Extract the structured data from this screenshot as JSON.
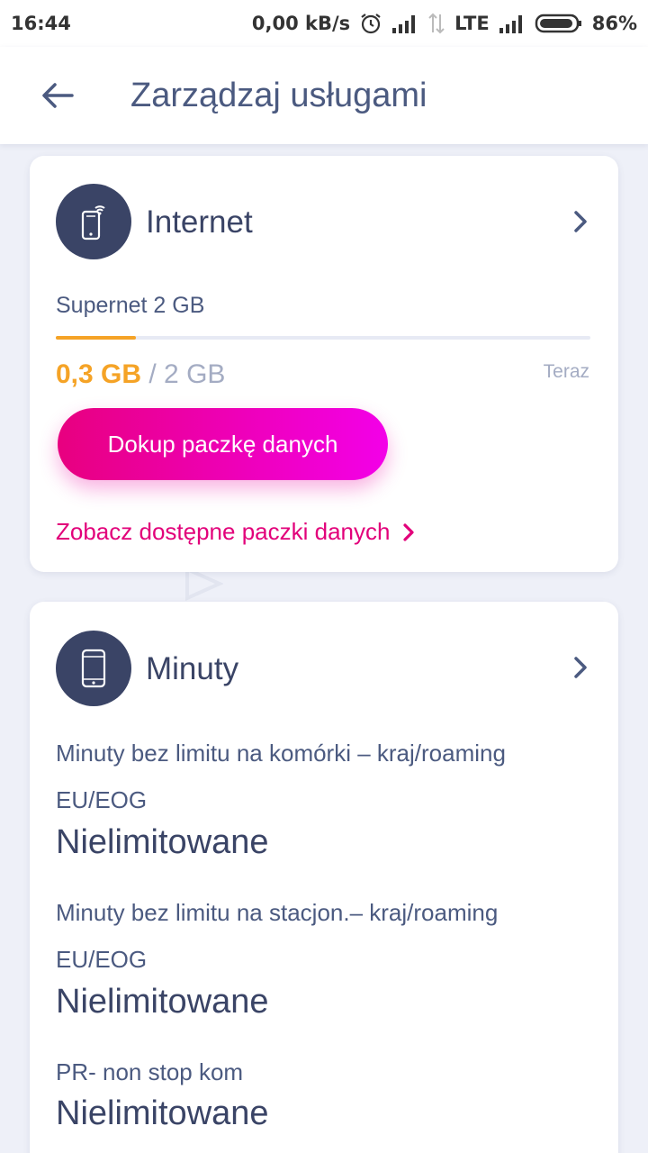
{
  "status_bar": {
    "time": "16:44",
    "speed": "0,00 kB/s",
    "network": "LTE",
    "battery": "86%"
  },
  "header": {
    "title": "Zarządzaj usługami",
    "back_icon": "arrow-left-icon"
  },
  "internet_card": {
    "title": "Internet",
    "icon": "phone-wifi-icon",
    "plan_name": "Supernet 2 GB",
    "used": "0,3 GB",
    "total": "/ 2 GB",
    "used_fraction": 0.15,
    "updated": "Teraz",
    "button_label": "Dokup paczkę danych",
    "link_label": "Zobacz dostępne paczki danych",
    "accent_color": "#f5a326",
    "brand_color": "#e2007a"
  },
  "minutes_card": {
    "title": "Minuty",
    "icon": "phone-icon",
    "items": [
      {
        "label_line1": "Minuty bez limitu na komórki – kraj/roaming",
        "label_line2": "EU/EOG",
        "value": "Nielimitowane"
      },
      {
        "label_line1": "Minuty bez limitu na stacjon.– kraj/roaming",
        "label_line2": "EU/EOG",
        "value": "Nielimitowane"
      },
      {
        "label_line1": "PR- non stop kom",
        "label_line2": "",
        "value": "Nielimitowane"
      }
    ]
  }
}
